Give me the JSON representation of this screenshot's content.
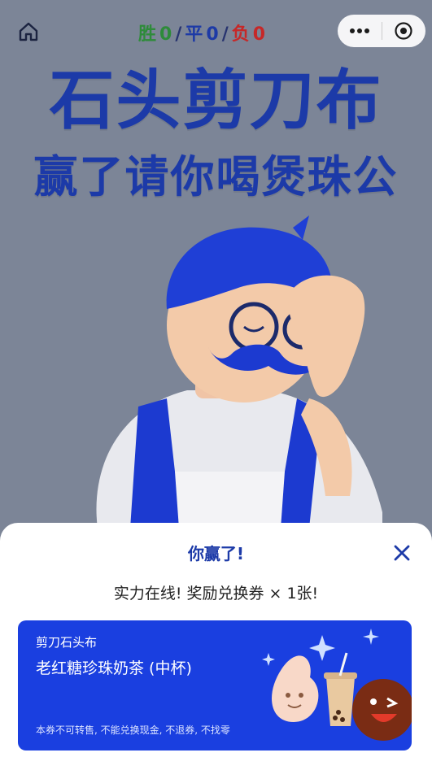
{
  "score": {
    "win_label": "胜",
    "win_count": "0",
    "draw_label": "平",
    "draw_count": "0",
    "lose_label": "负",
    "lose_count": "0",
    "separator": "/"
  },
  "hero": {
    "title_line1": "石头剪刀布",
    "title_line2": "赢了请你喝煲珠公"
  },
  "result_sheet": {
    "title": "你赢了!",
    "message": "实力在线! 奖励兑换券 × 1张!",
    "voucher": {
      "brand": "剪刀石头布",
      "product": "老红糖珍珠奶茶 (中杯)",
      "terms": "本券不可转售, 不能兑换现金, 不退券, 不找零"
    }
  },
  "icons": {
    "home": "home-icon",
    "more": "more-dots-icon",
    "target": "target-icon",
    "close": "close-icon"
  },
  "colors": {
    "background": "#7c8597",
    "title_blue": "#1c3aa8",
    "win_green": "#2e8b3a",
    "lose_red": "#c62828",
    "voucher_blue": "#1a3fe0"
  }
}
